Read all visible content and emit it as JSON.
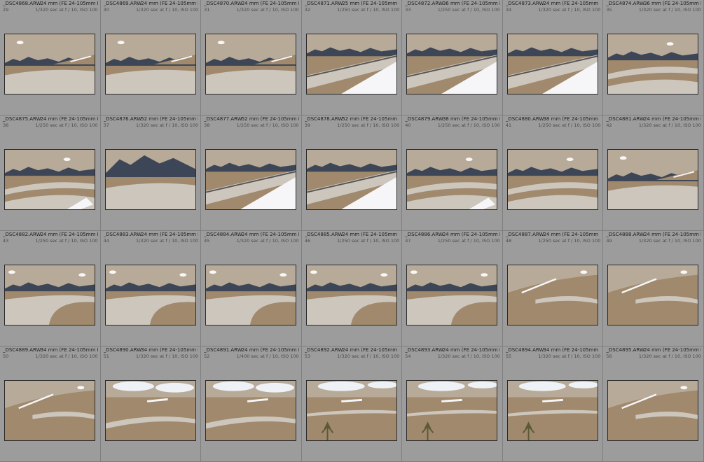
{
  "thumbnails": [
    {
      "file": "_DSC4868.ARW",
      "idx": "29",
      "lens": "24 mm (FE 24-105mm F4...",
      "exp": "1/320 sec at f / 10, ISO 100",
      "scene": "road-wide"
    },
    {
      "file": "_DSC4869.ARW",
      "idx": "30",
      "lens": "24 mm (FE 24-105mm F4...",
      "exp": "1/320 sec at f / 10, ISO 100",
      "scene": "road-wide"
    },
    {
      "file": "_DSC4870.ARW",
      "idx": "31",
      "lens": "24 mm (FE 24-105mm F4...",
      "exp": "1/320 sec at f / 10, ISO 100",
      "scene": "road-wide"
    },
    {
      "file": "_DSC4871.ARW",
      "idx": "32",
      "lens": "25 mm (FE 24-105mm F4 G...",
      "exp": "1/250 sec at f / 10, ISO 100",
      "scene": "snow-barrier"
    },
    {
      "file": "_DSC4872.ARW",
      "idx": "33",
      "lens": "36 mm (FE 24-105mm F4...",
      "exp": "1/250 sec at f / 10, ISO 100",
      "scene": "snow-barrier"
    },
    {
      "file": "_DSC4873.ARW",
      "idx": "34",
      "lens": "24 mm (FE 24-105mm F4...",
      "exp": "1/320 sec at f / 10, ISO 100",
      "scene": "snow-barrier"
    },
    {
      "file": "_DSC4874.ARW",
      "idx": "35",
      "lens": "36 mm (FE 24-105mm F4...",
      "exp": "1/320 sec at f / 10, ISO 100",
      "scene": "serpentine"
    },
    {
      "file": "_DSC4875.ARW",
      "idx": "36",
      "lens": "24 mm (FE 24-105mm F4...",
      "exp": "1/250 sec at f / 10, ISO 100",
      "scene": "serpentine-snow"
    },
    {
      "file": "_DSC4876.ARW",
      "idx": "37",
      "lens": "52 mm (FE 24-105mm F4...",
      "exp": "1/320 sec at f / 10, ISO 100",
      "scene": "mountain-road"
    },
    {
      "file": "_DSC4877.ARW",
      "idx": "38",
      "lens": "52 mm (FE 24-105mm F4 G...",
      "exp": "1/250 sec at f / 10, ISO 100",
      "scene": "snow-barrier"
    },
    {
      "file": "_DSC4878.ARW",
      "idx": "39",
      "lens": "52 mm (FE 24-105mm F4...",
      "exp": "1/250 sec at f / 10, ISO 100",
      "scene": "snow-barrier"
    },
    {
      "file": "_DSC4879.ARW",
      "idx": "40",
      "lens": "38 mm (FE 24-105mm F4...",
      "exp": "1/250 sec at f / 10, ISO 100",
      "scene": "serpentine-snow"
    },
    {
      "file": "_DSC4880.ARW",
      "idx": "41",
      "lens": "38 mm (FE 24-105mm F4...",
      "exp": "1/250 sec at f / 10, ISO 100",
      "scene": "serpentine"
    },
    {
      "file": "_DSC4881.ARW",
      "idx": "42",
      "lens": "24 mm (FE 24-105mm F4...",
      "exp": "1/320 sec at f / 10, ISO 100",
      "scene": "road-wide"
    },
    {
      "file": "_DSC4882.ARW",
      "idx": "43",
      "lens": "24 mm (FE 24-105mm F4...",
      "exp": "1/250 sec at f / 10, ISO 100",
      "scene": "road-curve"
    },
    {
      "file": "_DSC4883.ARW",
      "idx": "44",
      "lens": "24 mm (FE 24-105mm F4...",
      "exp": "1/320 sec at f / 10, ISO 100",
      "scene": "road-curve"
    },
    {
      "file": "_DSC4884.ARW",
      "idx": "45",
      "lens": "24 mm (FE 24-105mm F4...",
      "exp": "1/320 sec at f / 10, ISO 100",
      "scene": "road-curve"
    },
    {
      "file": "_DSC4885.ARW",
      "idx": "46",
      "lens": "24 mm (FE 24-105mm F4...",
      "exp": "1/250 sec at f / 10, ISO 100",
      "scene": "road-curve"
    },
    {
      "file": "_DSC4886.ARW",
      "idx": "47",
      "lens": "24 mm (FE 24-105mm F4...",
      "exp": "1/250 sec at f / 10, ISO 100",
      "scene": "road-curve"
    },
    {
      "file": "_DSC4887.ARW",
      "idx": "48",
      "lens": "24 mm (FE 24-105mm F4...",
      "exp": "1/250 sec at f / 10, ISO 100",
      "scene": "hill-meadow"
    },
    {
      "file": "_DSC4888.ARW",
      "idx": "49",
      "lens": "24 mm (FE 24-105mm F4...",
      "exp": "1/320 sec at f / 10, ISO 100",
      "scene": "hill-meadow"
    },
    {
      "file": "_DSC4889.ARW",
      "idx": "50",
      "lens": "34 mm (FE 24-105mm F4...",
      "exp": "1/320 sec at f / 10, ISO 100",
      "scene": "hill-meadow"
    },
    {
      "file": "_DSC4890.ARW",
      "idx": "51",
      "lens": "34 mm (FE 24-105mm F4...",
      "exp": "1/320 sec at f / 10, ISO 100",
      "scene": "meadow-clouds"
    },
    {
      "file": "_DSC4891.ARW",
      "idx": "52",
      "lens": "24 mm (FE 24-105mm F4...",
      "exp": "1/400 sec at f / 10, ISO 100",
      "scene": "meadow-clouds"
    },
    {
      "file": "_DSC4892.ARW",
      "idx": "53",
      "lens": "24 mm (FE 24-105mm F4...",
      "exp": "1/320 sec at f / 10, ISO 100",
      "scene": "meadow-shrub"
    },
    {
      "file": "_DSC4893.ARW",
      "idx": "54",
      "lens": "24 mm (FE 24-105mm F4...",
      "exp": "1/320 sec at f / 10, ISO 100",
      "scene": "meadow-shrub"
    },
    {
      "file": "_DSC4894.ARW",
      "idx": "55",
      "lens": "34 mm (FE 24-105mm F4...",
      "exp": "1/320 sec at f / 10, ISO 100",
      "scene": "meadow-shrub"
    },
    {
      "file": "_DSC4895.ARW",
      "idx": "56",
      "lens": "24 mm (FE 24-105mm F4...",
      "exp": "1/320 sec at f / 10, ISO 100",
      "scene": "hill-meadow"
    }
  ],
  "colors": {
    "panel_bg": "#9c9c9c",
    "grid_line": "#7e7e7e",
    "sky_top": "#2f5fa8",
    "sky_bottom": "#8fb4de",
    "mountain": "#3d4656",
    "road": "#cdc6bd",
    "meadow": "#a0896c",
    "snow": "#f6f6f8"
  }
}
